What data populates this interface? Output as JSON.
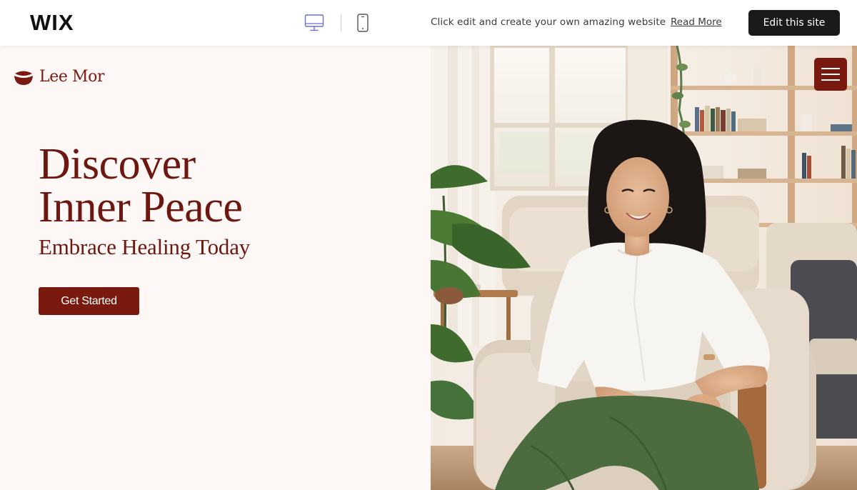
{
  "wix_bar": {
    "logo_text": "WIX",
    "device_icons": [
      "desktop-icon",
      "mobile-icon"
    ],
    "promo_text": "Click edit and create your own amazing website",
    "read_more": "Read More",
    "edit_button": "Edit this site"
  },
  "site": {
    "brand_name": "Lee Mor",
    "brand_icon": "bowl-logo-icon",
    "menu_icon": "hamburger-menu-icon",
    "hero": {
      "title_line1": "Discover",
      "title_line2": "Inner Peace",
      "subtitle": "Embrace Healing Today",
      "cta": "Get Started"
    },
    "photo_alt": "Woman in white shirt and green trousers seated in a beige armchair in a bright living room"
  },
  "colors": {
    "accent": "#7a1a0e",
    "heading": "#6e1710",
    "page_bg": "#fdf8f6",
    "topbar_button": "#1a1a1a",
    "device_icon_active": "#6f6fc9"
  }
}
